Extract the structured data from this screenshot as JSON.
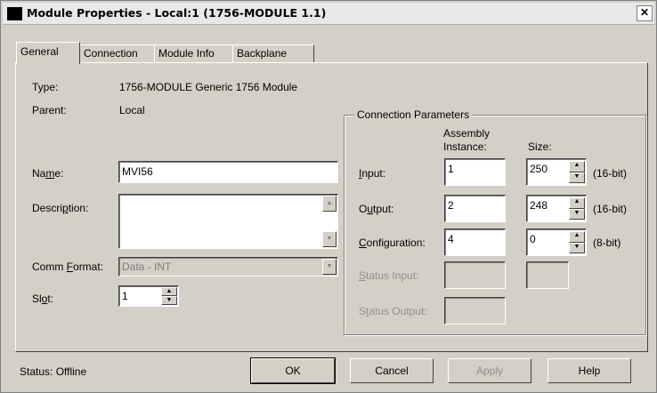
{
  "window": {
    "title": "Module Properties  - Local:1 (1756-MODULE 1.1)",
    "close_glyph": "✕"
  },
  "tabs": [
    {
      "label": "General"
    },
    {
      "label": "Connection"
    },
    {
      "label": "Module Info"
    },
    {
      "label": "Backplane"
    }
  ],
  "general": {
    "type_label": "Type:",
    "type_value": "1756-MODULE Generic 1756 Module",
    "parent_label": "Parent:",
    "parent_value": "Local",
    "name_label_pre": "Na",
    "name_label_u": "m",
    "name_label_post": "e:",
    "name_value": "MVI56",
    "description_label_pre": "Descri",
    "description_label_u": "p",
    "description_label_post": "tion:",
    "description_value": "",
    "comm_format_label_pre": "Comm ",
    "comm_format_label_u": "F",
    "comm_format_label_post": "ormat:",
    "comm_format_value": "Data - INT",
    "slot_label_pre": "Sl",
    "slot_label_u": "o",
    "slot_label_post": "t:",
    "slot_value": "1"
  },
  "connection_params": {
    "group_title": "Connection Parameters",
    "col_assembly_line1": "Assembly",
    "col_assembly_line2": "Instance:",
    "col_size": "Size:",
    "input_label_u": "I",
    "input_label_post": "nput:",
    "input_instance": "1",
    "input_size": "250",
    "input_unit": "(16-bit)",
    "output_label_u": "O",
    "output_label_mid": "u",
    "output_label_post": "tput:",
    "output_instance": "2",
    "output_size": "248",
    "output_unit": "(16-bit)",
    "config_label_u": "C",
    "config_label_post": "onfiguration:",
    "config_instance": "4",
    "config_size": "0",
    "config_unit": "(8-bit)",
    "status_input_label_u": "S",
    "status_input_label_post": "tatus Input:",
    "status_output_label_pre": "S",
    "status_output_label_u": "t",
    "status_output_label_post": "atus Output:"
  },
  "footer": {
    "status_text": "Status:  Offline",
    "ok_label": "OK",
    "cancel_label": "Cancel",
    "apply_label": "Apply",
    "help_label": "Help"
  }
}
